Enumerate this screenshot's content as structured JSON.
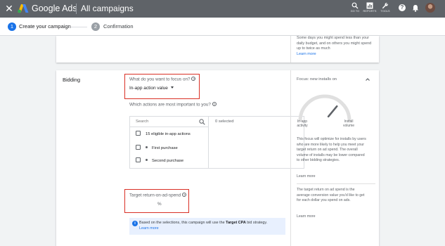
{
  "header": {
    "close_glyph": "✕",
    "brand": "Google Ads",
    "page_title": "All campaigns",
    "tools": [
      {
        "icon": "search-icon",
        "label": "GO TO"
      },
      {
        "icon": "reports-icon",
        "label": "REPORTS"
      },
      {
        "icon": "wrench-icon",
        "label": "TOOLS"
      }
    ],
    "help_glyph": "?"
  },
  "stepper": {
    "steps": [
      {
        "number": "1",
        "label": "Create your campaign"
      },
      {
        "number": "2",
        "label": "Confirmation"
      }
    ]
  },
  "budget_panel": {
    "note": "Some days you might spend less than your daily budget, and on others you might spend up to twice as much",
    "link": "Learn more"
  },
  "bidding": {
    "section_title": "Bidding",
    "focus_question": "What do you want to focus on?",
    "focus_value": "In-app action value",
    "actions_question": "Which actions are most important to you?",
    "search_placeholder": "Search",
    "selected_count": "0 selected",
    "options": [
      {
        "label": "15 eligible in-app actions"
      },
      {
        "label": "First purchase"
      },
      {
        "label": "Second purchase"
      }
    ],
    "troas_label": "Target return-on-ad-spend",
    "troas_unit": "%",
    "info_prefix": "Based on the selections, this campaign will use the",
    "info_strategy": "Target CPA",
    "info_suffix": "bid strategy.",
    "info_link": "Learn more"
  },
  "side_panel": {
    "title": "Focus: new installs on",
    "gauge_left": "In-app activity",
    "gauge_right": "Install volume",
    "gauge_level": 0.72,
    "text1": "This focus will optimize for installs by users who are more likely to help you meet your target return on ad spend. The overall volume of installs may be lower compared to other bidding strategies.",
    "link1": "Learn more",
    "text2": "The target return on ad spend is the average conversion value you'd like to get for each dollar you spend on ads.",
    "link2": "Learn more"
  },
  "colors": {
    "accent": "#1a73e8",
    "highlight": "#d93025",
    "header": "#5f6368"
  }
}
